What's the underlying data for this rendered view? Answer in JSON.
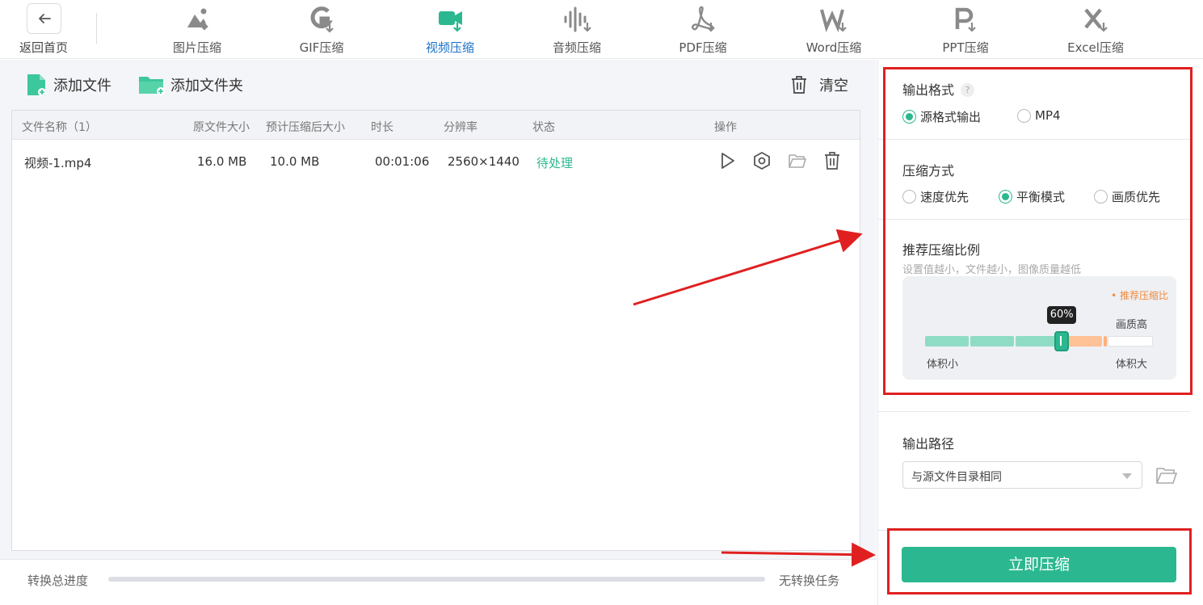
{
  "nav": {
    "back_label": "返回首页",
    "tabs": [
      {
        "label": "图片压缩",
        "icon": "image-compress-icon"
      },
      {
        "label": "GIF压缩",
        "icon": "gif-compress-icon"
      },
      {
        "label": "视频压缩",
        "icon": "video-compress-icon",
        "active": true
      },
      {
        "label": "音频压缩",
        "icon": "audio-compress-icon"
      },
      {
        "label": "PDF压缩",
        "icon": "pdf-compress-icon"
      },
      {
        "label": "Word压缩",
        "icon": "word-compress-icon"
      },
      {
        "label": "PPT压缩",
        "icon": "ppt-compress-icon"
      },
      {
        "label": "Excel压缩",
        "icon": "excel-compress-icon"
      }
    ]
  },
  "toolbar": {
    "add_file": "添加文件",
    "add_folder": "添加文件夹",
    "clear": "清空"
  },
  "table": {
    "headers": {
      "name": "文件名称（1）",
      "orig_size": "原文件大小",
      "est_size": "预计压缩后大小",
      "duration": "时长",
      "resolution": "分辨率",
      "status": "状态",
      "actions": "操作"
    },
    "rows": [
      {
        "name": "视频-1.mp4",
        "orig_size": "16.0 MB",
        "est_size": "10.0 MB",
        "duration": "00:01:06",
        "resolution": "2560×1440",
        "status": "待处理"
      }
    ]
  },
  "progress": {
    "label": "转换总进度",
    "status": "无转换任务",
    "value": 0
  },
  "settings": {
    "output_format": {
      "title": "输出格式",
      "help": "?",
      "options": [
        "源格式输出",
        "MP4"
      ],
      "selected": "源格式输出"
    },
    "compress_mode": {
      "title": "压缩方式",
      "options": [
        "速度优先",
        "平衡模式",
        "画质优先"
      ],
      "selected": "平衡模式"
    },
    "ratio": {
      "title": "推荐压缩比例",
      "hint": "设置值越小，文件越小，图像质量越低",
      "legend": "• 推荐压缩比",
      "value_label": "60%",
      "value": 60,
      "left_label": "体积小",
      "right_label": "体积大",
      "top_right_label": "画质高"
    },
    "output_path": {
      "title": "输出路径",
      "value": "与源文件目录相同"
    },
    "start_button": "立即压缩"
  },
  "colors": {
    "accent": "#2bb890",
    "active_tab": "#1a73c8",
    "recommend": "#f08a3c",
    "annotation": "#e02020"
  }
}
